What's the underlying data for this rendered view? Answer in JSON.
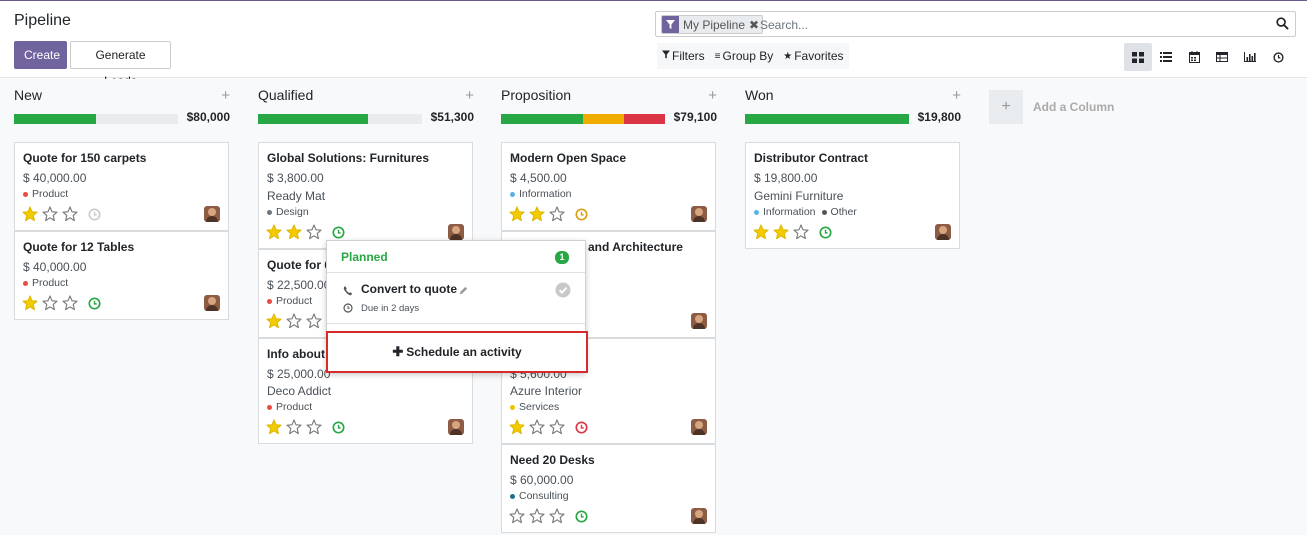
{
  "app": {
    "title": "Pipeline",
    "create_label": "Create",
    "generate_label": "Generate Leads",
    "accent": "#71639e"
  },
  "search": {
    "facet_label": "My Pipeline",
    "placeholder": "Search..."
  },
  "filters": {
    "filters_label": "Filters",
    "groupby_label": "Group By",
    "favorites_label": "Favorites"
  },
  "views": [
    "kanban-icon",
    "list-icon",
    "calendar-icon",
    "pivot-icon",
    "graph-icon",
    "activity-icon"
  ],
  "columns": [
    {
      "title": "New",
      "total": "$80,000",
      "progress": [
        {
          "color": "#28a745",
          "fraction": 0.5
        }
      ],
      "cards": [
        {
          "title": "Quote for 150 carpets",
          "amount": "$ 40,000.00",
          "company": "",
          "tags": [
            {
              "label": "Product",
              "color": "#e74c3c"
            }
          ],
          "stars": 1,
          "activity": "none"
        },
        {
          "title": "Quote for 12 Tables",
          "amount": "$ 40,000.00",
          "company": "",
          "tags": [
            {
              "label": "Product",
              "color": "#e74c3c"
            }
          ],
          "stars": 1,
          "activity": "planned"
        }
      ]
    },
    {
      "title": "Qualified",
      "total": "$51,300",
      "progress": [
        {
          "color": "#28a745",
          "fraction": 0.67
        }
      ],
      "cards": [
        {
          "title": "Global Solutions: Furnitures",
          "amount": "$ 3,800.00",
          "company": "Ready Mat",
          "tags": [
            {
              "label": "Design",
              "color": "#6c757d"
            }
          ],
          "stars": 2,
          "activity": "planned"
        },
        {
          "title": "Quote for 6",
          "amount": "$ 22,500.00",
          "company": "",
          "tags": [
            {
              "label": "Product",
              "color": "#e74c3c"
            }
          ],
          "stars": 1,
          "activity": "planned"
        },
        {
          "title": "Info about",
          "amount": "$ 25,000.00",
          "company": "Deco Addict",
          "tags": [
            {
              "label": "Product",
              "color": "#e74c3c"
            }
          ],
          "stars": 1,
          "activity": "planned"
        }
      ]
    },
    {
      "title": "Proposition",
      "total": "$79,100",
      "progress": [
        {
          "color": "#28a745",
          "fraction": 0.5
        },
        {
          "color": "#f0ad00",
          "fraction": 0.25
        },
        {
          "color": "#dc3545",
          "fraction": 0.25
        }
      ],
      "cards": [
        {
          "title": "Modern Open Space",
          "amount": "$ 4,500.00",
          "company": "",
          "tags": [
            {
              "label": "Information",
              "color": "#5ab0e6"
            }
          ],
          "stars": 2,
          "activity": "today"
        },
        {
          "title": "and Architecture",
          "amount": "",
          "company": "",
          "tags": [],
          "stars": 0,
          "activity": "none"
        },
        {
          "title": "",
          "amount": "$ 5,600.00",
          "company": "Azure Interior",
          "tags": [
            {
              "label": "Services",
              "color": "#f0c000"
            }
          ],
          "stars": 1,
          "activity": "overdue"
        },
        {
          "title": "Need 20 Desks",
          "amount": "$ 60,000.00",
          "company": "",
          "tags": [
            {
              "label": "Consulting",
              "color": "#1f6f8b"
            }
          ],
          "stars": 0,
          "activity": "planned"
        }
      ]
    },
    {
      "title": "Won",
      "total": "$19,800",
      "progress": [
        {
          "color": "#28a745",
          "fraction": 1.0
        }
      ],
      "cards": [
        {
          "title": "Distributor Contract",
          "amount": "$ 19,800.00",
          "company": "Gemini Furniture",
          "tags": [
            {
              "label": "Information",
              "color": "#5ab0e6"
            },
            {
              "label": "Other",
              "color": "#555"
            }
          ],
          "stars": 2,
          "activity": "planned"
        }
      ]
    }
  ],
  "add_column_label": "Add a Column",
  "popover": {
    "header": "Planned",
    "count": "1",
    "activity_title": "Convert to quote",
    "activity_due": "Due in 2 days",
    "schedule_label": "Schedule an activity"
  }
}
